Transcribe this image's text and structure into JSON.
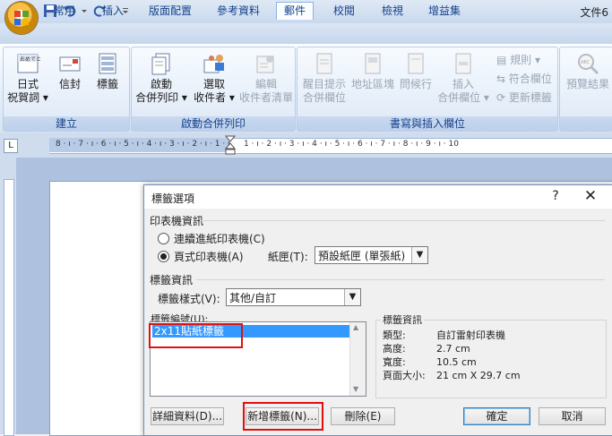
{
  "app": {
    "doc_title": "文件6"
  },
  "tabs": [
    "常用",
    "插入",
    "版面配置",
    "參考資料",
    "郵件",
    "校閱",
    "檢視",
    "增益集"
  ],
  "active_tab": 4,
  "ribbon": {
    "groups": {
      "create": {
        "label": "建立",
        "buttons": {
          "envelope_jp": [
            "日式",
            "祝賀詞 ▾"
          ],
          "envelope": "信封",
          "labels": "標籤"
        }
      },
      "merge": {
        "label": "啟動合併列印",
        "buttons": {
          "start": [
            "啟動",
            "合併列印 ▾"
          ],
          "select": [
            "選取",
            "收件者 ▾"
          ],
          "edit": [
            "編輯",
            "收件者清單"
          ]
        }
      },
      "fields": {
        "label": "書寫與插入欄位",
        "buttons": {
          "highlight": [
            "醒目提示",
            "合併欄位"
          ],
          "address": "地址區塊",
          "greeting": "問候行",
          "insert": [
            "插入",
            "合併欄位 ▾"
          ]
        },
        "small": [
          "規則 ▾",
          "符合欄位",
          "更新標籤"
        ]
      },
      "preview": {
        "buttons": {
          "preview": "預覽結果"
        }
      }
    }
  },
  "ruler": {
    "numbers": "8 · ı · 7 · ı · 6 · ı · 5 · ı · 4 · ı · 3 · ı · 2 · ı · 1 · ı",
    "right": "1 · ı · 2 · ı · 3 · ı · 4 · ı · 5 · ı · 6 · ı · 7 · ı · 8 · ı · 9 · ı · 10"
  },
  "dialog": {
    "title": "標籤選項",
    "help": "?",
    "close": "✕",
    "printer_section": "印表機資訊",
    "continuous": "連續進紙印表機(C)",
    "page_printer": "頁式印表機(A)",
    "tray_label": "紙匣(T):",
    "tray_value": "預設紙匣 (單張紙)",
    "label_info_section": "標籤資訊",
    "vendor_label": "標籤樣式(V):",
    "vendor_value": "其他/自訂",
    "product_label": "標籤編號(U):",
    "product_selected": "2x11貼紙標籤",
    "info_title": "標籤資訊",
    "info": [
      {
        "key": "類型:",
        "value": "自訂雷射印表機"
      },
      {
        "key": "高度:",
        "value": "2.7 cm"
      },
      {
        "key": "寬度:",
        "value": "10.5 cm"
      },
      {
        "key": "頁面大小:",
        "value": "21 cm X 29.7 cm"
      }
    ],
    "buttons": {
      "details": "詳細資料(D)...",
      "new_label": "新增標籤(N)...",
      "delete": "刪除(E)",
      "ok": "確定",
      "cancel": "取消"
    }
  }
}
